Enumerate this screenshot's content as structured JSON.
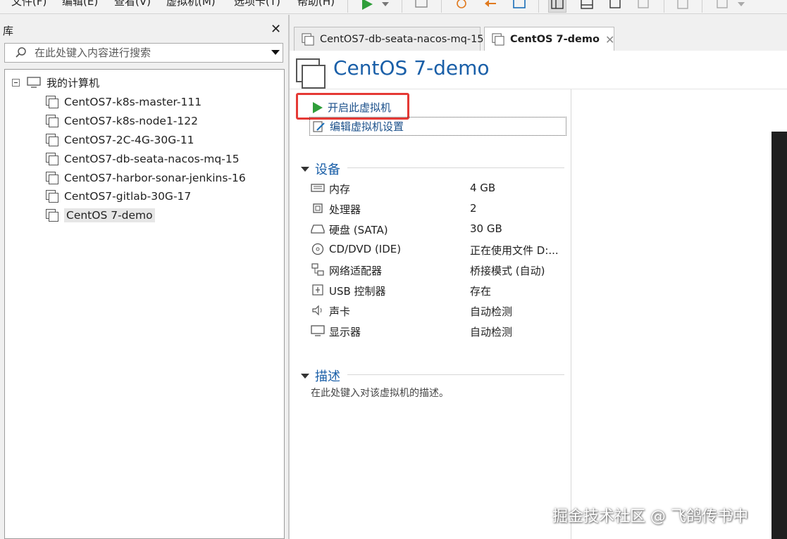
{
  "menu": [
    "文件(F)",
    "编辑(E)",
    "查看(V)",
    "虚拟机(M)",
    "选项卡(T)",
    "帮助(H)"
  ],
  "library": {
    "title": "库",
    "search_placeholder": "在此处键入内容进行搜索",
    "root_label": "我的计算机",
    "vms": [
      "CentOS7-k8s-master-111",
      "CentOS7-k8s-node1-122",
      "CentOS7-2C-4G-30G-11",
      "CentOS7-db-seata-nacos-mq-15",
      "CentOS7-harbor-sonar-jenkins-16",
      "CentOS7-gitlab-30G-17",
      "CentOS 7-demo"
    ],
    "selected_vm": "CentOS 7-demo"
  },
  "tabs": [
    {
      "label": "CentOS7-db-seata-nacos-mq-15",
      "active": false
    },
    {
      "label": "CentOS 7-demo",
      "active": true
    }
  ],
  "vm": {
    "title": "CentOS 7-demo",
    "start_action": "开启此虚拟机",
    "edit_action": "编辑虚拟机设置",
    "devices_heading": "设备",
    "devices": [
      {
        "icon": "memory-icon",
        "name": "内存",
        "value": "4 GB"
      },
      {
        "icon": "cpu-icon",
        "name": "处理器",
        "value": "2"
      },
      {
        "icon": "hard-disk-icon",
        "name": "硬盘 (SATA)",
        "value": "30 GB"
      },
      {
        "icon": "cd-dvd-icon",
        "name": "CD/DVD (IDE)",
        "value": "正在使用文件 D:..."
      },
      {
        "icon": "network-icon",
        "name": "网络适配器",
        "value": "桥接模式 (自动)"
      },
      {
        "icon": "usb-icon",
        "name": "USB 控制器",
        "value": "存在"
      },
      {
        "icon": "speaker-icon",
        "name": "声卡",
        "value": "自动检测"
      },
      {
        "icon": "monitor-icon",
        "name": "显示器",
        "value": "自动检测"
      }
    ],
    "description_heading": "描述",
    "description_placeholder": "在此处键入对该虚拟机的描述。"
  },
  "watermark": "掘金技术社区 @ 飞鸽传书中",
  "colors": {
    "accent": "#1a5fa8",
    "highlight": "#e53935",
    "play": "#2f9e3a"
  }
}
